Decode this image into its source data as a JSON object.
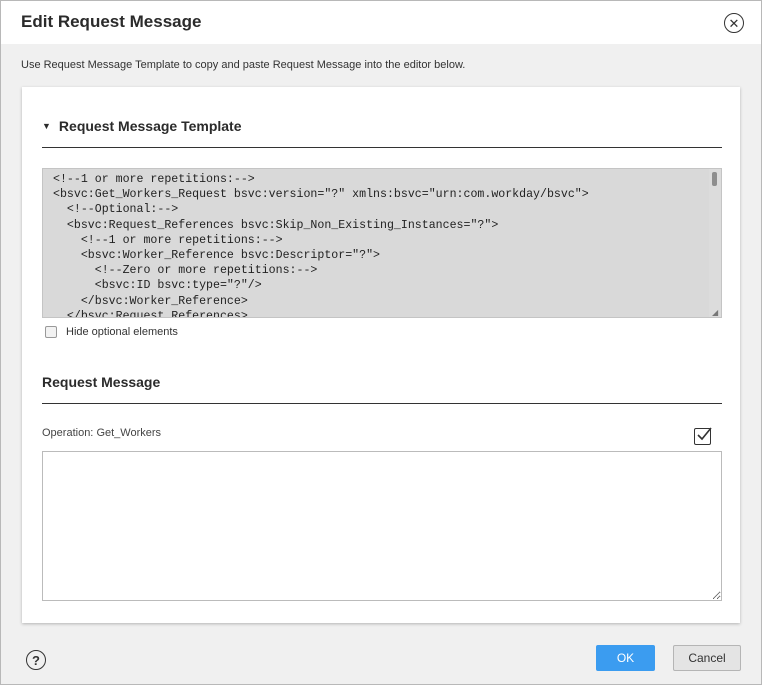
{
  "dialog": {
    "title": "Edit Request Message",
    "intro": "Use Request Message Template to copy and paste Request Message into the editor below."
  },
  "template_section": {
    "title": "Request Message Template",
    "caret_icon": "caret-down-icon",
    "code": "<!--1 or more repetitions:-->\n<bsvc:Get_Workers_Request bsvc:version=\"?\" xmlns:bsvc=\"urn:com.workday/bsvc\">\n  <!--Optional:-->\n  <bsvc:Request_References bsvc:Skip_Non_Existing_Instances=\"?\">\n    <!--1 or more repetitions:-->\n    <bsvc:Worker_Reference bsvc:Descriptor=\"?\">\n      <!--Zero or more repetitions:-->\n      <bsvc:ID bsvc:type=\"?\"/>\n    </bsvc:Worker_Reference>\n  </bsvc:Request_References>",
    "hide_optional_label": "Hide optional elements"
  },
  "request_section": {
    "title": "Request Message",
    "operation_label": "Operation:",
    "operation_value": "Get_Workers",
    "editor_value": ""
  },
  "footer": {
    "ok_label": "OK",
    "cancel_label": "Cancel",
    "help_symbol": "?"
  },
  "icons": {
    "close": "close-icon",
    "help": "help-icon",
    "edit": "edit-checkbox-icon"
  },
  "colors": {
    "primary_button": "#3b9cf0",
    "template_background": "#d9d9d9",
    "dialog_background": "#f0f0f0"
  }
}
